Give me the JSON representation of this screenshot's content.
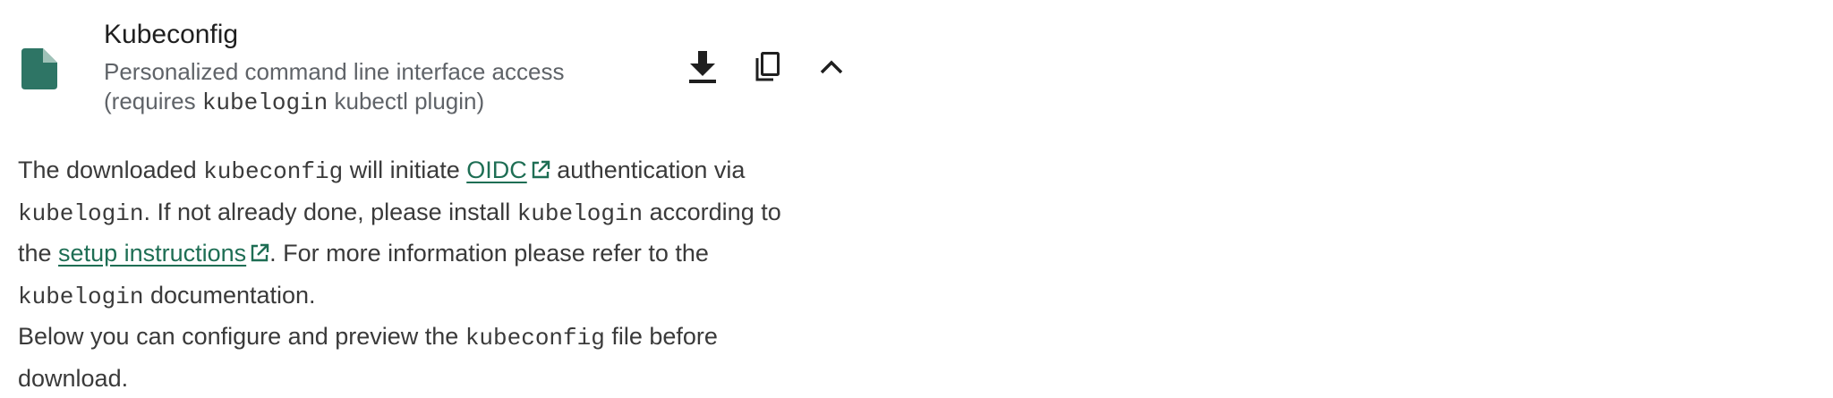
{
  "header": {
    "title": "Kubeconfig",
    "subtitle_line1": "Personalized command line interface access",
    "subtitle_open": "(requires ",
    "subtitle_code": "kubelogin",
    "subtitle_close": " kubectl plugin)",
    "icon": "file-icon"
  },
  "actions": {
    "download_icon": "download-icon",
    "copy_icon": "copy-icon",
    "collapse_icon": "chevron-up-icon"
  },
  "description": {
    "p1_t1": "The downloaded ",
    "p1_c1": "kubeconfig",
    "p1_t2": " will initiate ",
    "oidc_link": "OIDC",
    "p1_t3": " authentication via",
    "p1_c2": "kubelogin",
    "p1_t4": ". If not already done, please install ",
    "p1_c3": "kubelogin",
    "p1_t5": " according to",
    "p1_t6": "the ",
    "setup_link": "setup instructions",
    "p1_t7": ". For more information please refer to the",
    "p1_c4": "kubelogin",
    "p1_t8": " documentation.",
    "p2_t1": "Below you can configure and preview the ",
    "p2_c1": "kubeconfig",
    "p2_t2": " file before",
    "p2_t3": "download."
  },
  "colors": {
    "accent": "#2e7565",
    "link": "#1e6e54",
    "text": "#3a3a3a",
    "subtle": "#5f6368"
  }
}
